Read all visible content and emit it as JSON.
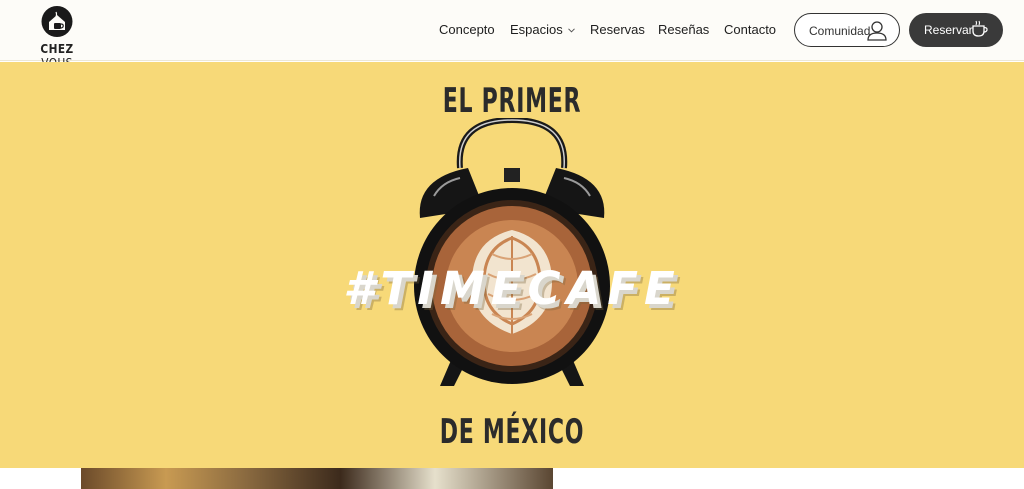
{
  "brand": {
    "name_bold": "CHEZ",
    "name_light": "VOUS"
  },
  "nav": {
    "items": [
      {
        "label": "Concepto"
      },
      {
        "label": "Espacios"
      },
      {
        "label": "Reservas"
      },
      {
        "label": "Reseñas"
      },
      {
        "label": "Contacto"
      }
    ]
  },
  "actions": {
    "community_label": "Comunidad",
    "community_icon": "user-icon",
    "reserve_label": "Reservar",
    "reserve_icon": "coffee-cup-icon"
  },
  "hero": {
    "line_top": "EL PRIMER",
    "hashtag": "#TIMECAFE",
    "line_bottom": "DE MÉXICO",
    "background_color": "#f7d978",
    "illustration": "alarm-clock-latte-art-icon"
  }
}
